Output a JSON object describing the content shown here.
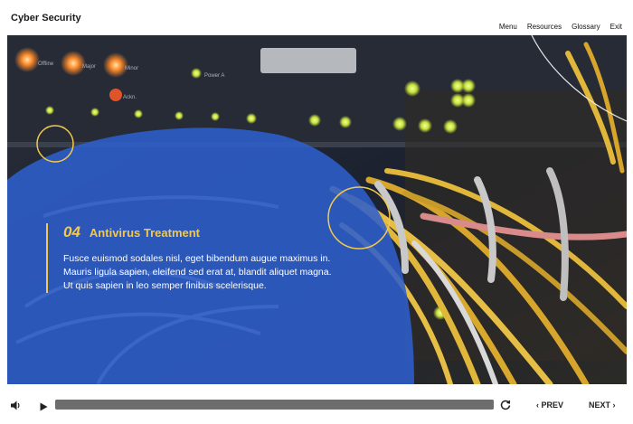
{
  "header": {
    "course_title": "Cyber Security",
    "nav": {
      "menu": "Menu",
      "resources": "Resources",
      "glossary": "Glossary",
      "exit": "Exit"
    }
  },
  "slide": {
    "number": "04",
    "title": "Antivirus Treatment",
    "body": "Fusce euismod sodales nisl, eget bibendum augue maximus in. Mauris ligula sapien, eleifend sed erat at, blandit aliquet magna. Ut quis sapien in leo semper finibus scelerisque.",
    "background_labels": {
      "offline": "Offline",
      "major": "Major",
      "minor": "Minor",
      "power_a": "Power A",
      "ackn": "Ackn."
    }
  },
  "player": {
    "progress_fraction": 1.0,
    "prev_label": "PREV",
    "next_label": "NEXT",
    "prev_icon": "chevron-left-icon",
    "next_icon": "chevron-right-icon",
    "volume_icon": "volume-icon",
    "play_icon": "play-icon",
    "replay_icon": "replay-icon"
  },
  "colors": {
    "accent_yellow": "#f2c94c",
    "overlay_blue": "#2d5fcc",
    "progress_track": "#9b9b9b"
  }
}
